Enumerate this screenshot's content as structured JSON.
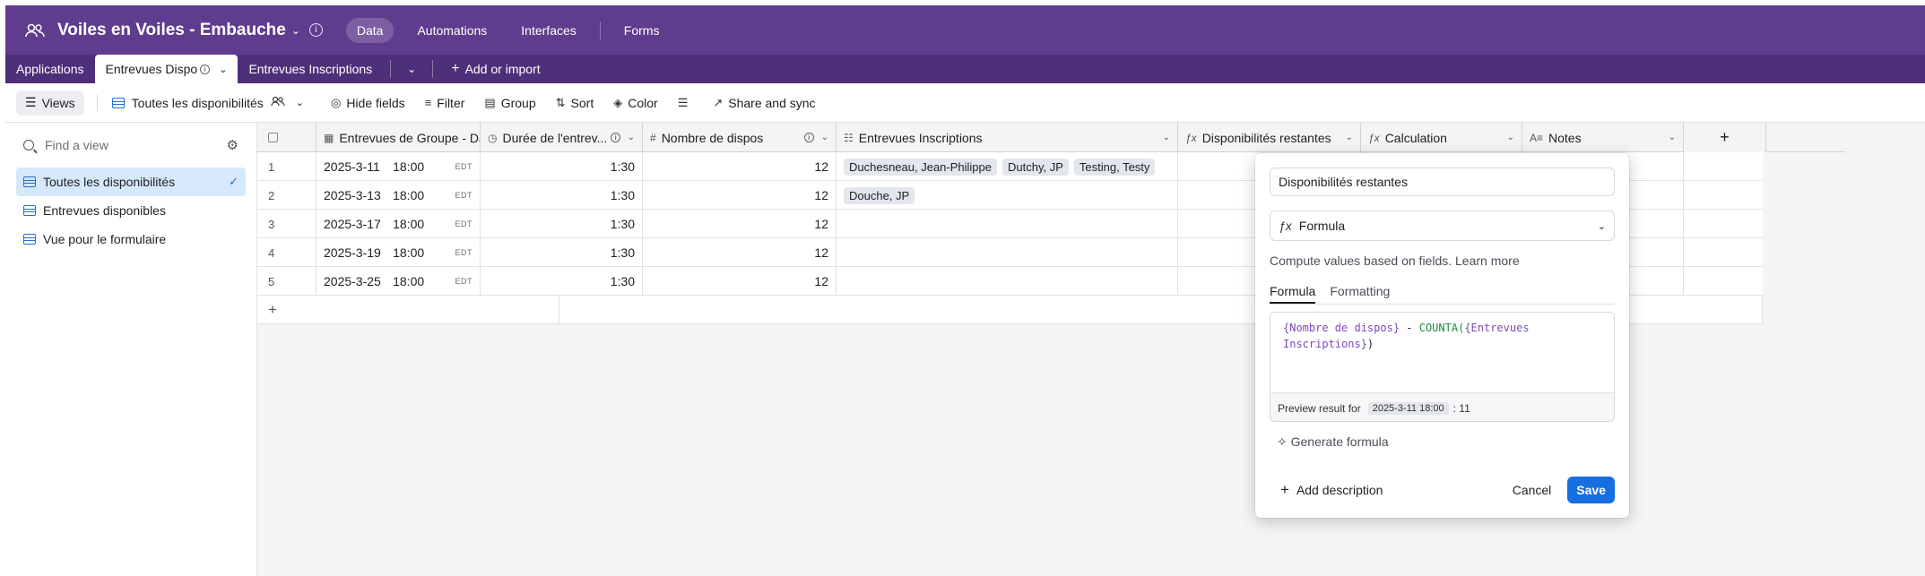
{
  "header": {
    "base_name": "Voiles en Voiles - Embauche",
    "nav": [
      "Data",
      "Automations",
      "Interfaces",
      "Forms"
    ],
    "active_nav": "Data"
  },
  "tables": {
    "items": [
      "Applications",
      "Entrevues Dispo",
      "Entrevues Inscriptions"
    ],
    "add_label": "Add or import"
  },
  "toolbar": {
    "views_label": "Views",
    "current_view": "Toutes les disponibilités",
    "hide_fields": "Hide fields",
    "filter": "Filter",
    "group": "Group",
    "sort": "Sort",
    "color": "Color",
    "share": "Share and sync"
  },
  "sidebar": {
    "find_placeholder": "Find a view",
    "views": [
      "Toutes les disponibilités",
      "Entrevues disponibles",
      "Vue pour le formulaire"
    ]
  },
  "columns": [
    "Entrevues de Groupe - Date",
    "Durée de l'entrev...",
    "Nombre de dispos",
    "Entrevues Inscriptions",
    "Disponibilités restantes",
    "Calculation",
    "Notes"
  ],
  "rows": [
    {
      "n": "1",
      "date": "2025-3-11",
      "time": "18:00",
      "tz": "EDT",
      "dur": "1:30",
      "nb": "12",
      "chips": [
        "Duchesneau, Jean-Philippe",
        "Dutchy, JP",
        "Testing, Testy"
      ]
    },
    {
      "n": "2",
      "date": "2025-3-13",
      "time": "18:00",
      "tz": "EDT",
      "dur": "1:30",
      "nb": "12",
      "chips": [
        "Douche, JP"
      ]
    },
    {
      "n": "3",
      "date": "2025-3-17",
      "time": "18:00",
      "tz": "EDT",
      "dur": "1:30",
      "nb": "12",
      "chips": []
    },
    {
      "n": "4",
      "date": "2025-3-19",
      "time": "18:00",
      "tz": "EDT",
      "dur": "1:30",
      "nb": "12",
      "chips": []
    },
    {
      "n": "5",
      "date": "2025-3-25",
      "time": "18:00",
      "tz": "EDT",
      "dur": "1:30",
      "nb": "12",
      "chips": []
    }
  ],
  "popup": {
    "field_name": "Disponibilités restantes",
    "field_type": "Formula",
    "description": "Compute values based on fields.",
    "learn_more": "Learn more",
    "tabs": [
      "Formula",
      "Formatting"
    ],
    "formula_field1": "{Nombre de dispos}",
    "formula_op": " - ",
    "formula_fn": "COUNTA(",
    "formula_field2a": "{Entrevues",
    "formula_field2b": "Inscriptions}",
    "formula_close": ")",
    "preview_label": "Preview result for",
    "preview_record": "2025-3-11 18:00",
    "preview_result": ": 11",
    "generate": "Generate formula",
    "add_description": "Add description",
    "cancel": "Cancel",
    "save": "Save"
  }
}
